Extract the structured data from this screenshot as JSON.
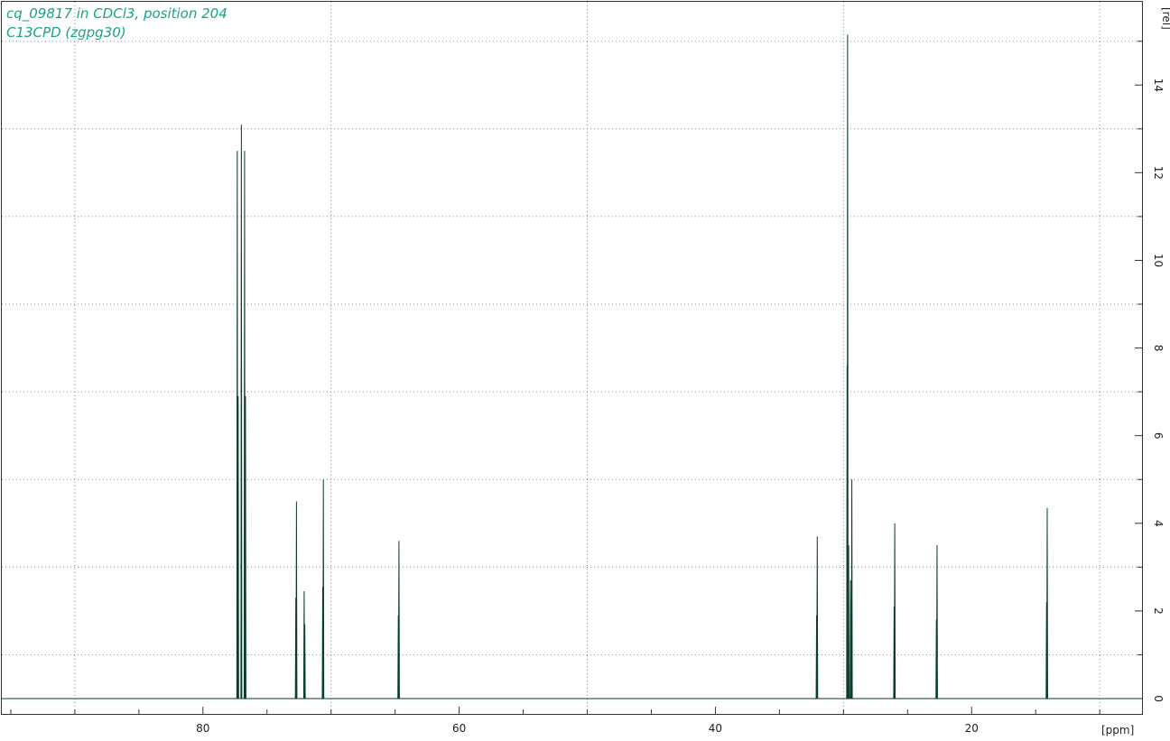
{
  "header": {
    "line1": "cq_09817 in CDCl3, position 204",
    "line2": "C13CPD (zgpg30)"
  },
  "chart_data": {
    "type": "line",
    "title": "",
    "xlabel": "[ppm]",
    "ylabel": "[rel]",
    "x_reversed": true,
    "xlim": [
      95.7,
      6.7
    ],
    "ylim": [
      -0.35,
      15.9
    ],
    "x_ticks": [
      80,
      60,
      40,
      20
    ],
    "y_ticks": [
      0,
      2,
      4,
      6,
      8,
      10,
      12,
      14
    ],
    "grid": true,
    "colors": {
      "spectrum": "#0a3d2e",
      "header_text": "#1aa286",
      "grid": "#888888"
    },
    "peaks": [
      {
        "ppm": 77.32,
        "height": 12.5
      },
      {
        "ppm": 77.25,
        "height": 6.9
      },
      {
        "ppm": 77.0,
        "height": 13.1
      },
      {
        "ppm": 76.75,
        "height": 12.5
      },
      {
        "ppm": 76.68,
        "height": 6.9
      },
      {
        "ppm": 72.7,
        "height": 4.5
      },
      {
        "ppm": 72.75,
        "height": 2.3
      },
      {
        "ppm": 72.1,
        "height": 2.45
      },
      {
        "ppm": 72.05,
        "height": 1.7
      },
      {
        "ppm": 70.6,
        "height": 5.0
      },
      {
        "ppm": 70.65,
        "height": 2.55
      },
      {
        "ppm": 64.7,
        "height": 3.6
      },
      {
        "ppm": 64.75,
        "height": 1.9
      },
      {
        "ppm": 32.05,
        "height": 3.7
      },
      {
        "ppm": 32.1,
        "height": 1.9
      },
      {
        "ppm": 29.68,
        "height": 15.15
      },
      {
        "ppm": 29.72,
        "height": 7.6
      },
      {
        "ppm": 29.6,
        "height": 3.5
      },
      {
        "ppm": 29.45,
        "height": 2.7
      },
      {
        "ppm": 29.35,
        "height": 5.0
      },
      {
        "ppm": 26.0,
        "height": 4.0
      },
      {
        "ppm": 26.05,
        "height": 2.1
      },
      {
        "ppm": 22.7,
        "height": 3.5
      },
      {
        "ppm": 22.75,
        "height": 1.8
      },
      {
        "ppm": 14.1,
        "height": 4.35
      },
      {
        "ppm": 14.15,
        "height": 2.2
      }
    ]
  }
}
